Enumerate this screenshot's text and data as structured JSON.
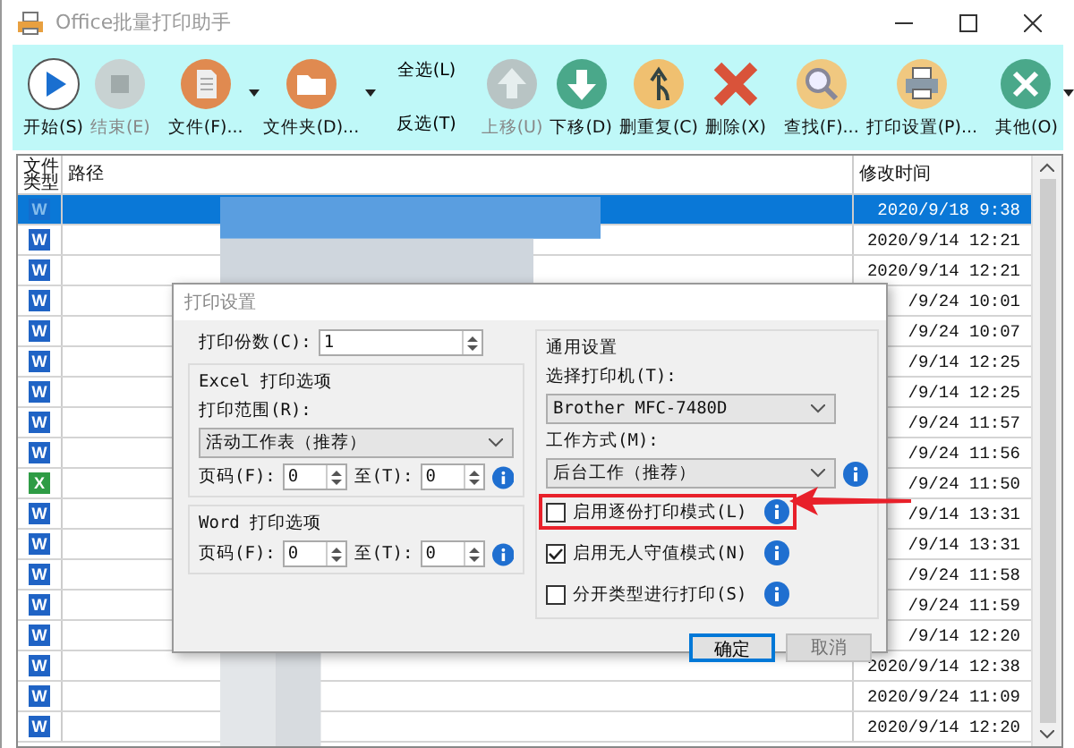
{
  "window": {
    "title": "Office批量打印助手"
  },
  "toolbar": [
    {
      "kind": "button",
      "label": "开始(S)",
      "disabled": false,
      "dropdown": false
    },
    {
      "kind": "button",
      "label": "结束(E)",
      "disabled": true,
      "dropdown": false
    },
    {
      "kind": "separator"
    },
    {
      "kind": "button",
      "label": "文件(F)...",
      "disabled": false,
      "dropdown": true
    },
    {
      "kind": "button",
      "label": "文件夹(D)...",
      "disabled": false,
      "dropdown": true
    },
    {
      "kind": "separator"
    },
    {
      "kind": "stack",
      "labels": [
        "全选(L)",
        "反选(T)"
      ]
    },
    {
      "kind": "separator"
    },
    {
      "kind": "button",
      "label": "上移(U)",
      "disabled": true,
      "dropdown": false
    },
    {
      "kind": "button",
      "label": "下移(D)",
      "disabled": false,
      "dropdown": false
    },
    {
      "kind": "button",
      "label": "删重复(C)",
      "disabled": false,
      "dropdown": false
    },
    {
      "kind": "button",
      "label": "删除(X)",
      "disabled": false,
      "dropdown": false
    },
    {
      "kind": "separator"
    },
    {
      "kind": "button",
      "label": "查找(F)...",
      "disabled": false,
      "dropdown": false
    },
    {
      "kind": "button",
      "label": "打印设置(P)...",
      "disabled": false,
      "dropdown": false
    },
    {
      "kind": "separator"
    },
    {
      "kind": "button",
      "label": "其他(O)",
      "disabled": false,
      "dropdown": true
    }
  ],
  "table": {
    "columns": [
      "文件类型",
      "路径",
      "修改时间"
    ],
    "rows": [
      {
        "kind": "word",
        "letter": "W",
        "time": "2020/9/18 9:38",
        "selected": true
      },
      {
        "kind": "word",
        "letter": "W",
        "time": "2020/9/14 12:21",
        "selected": false
      },
      {
        "kind": "word",
        "letter": "W",
        "time": "2020/9/14 12:21",
        "selected": false
      },
      {
        "kind": "word",
        "letter": "W",
        "time": "/9/24 10:01",
        "selected": false
      },
      {
        "kind": "word",
        "letter": "W",
        "time": "/9/24 10:07",
        "selected": false
      },
      {
        "kind": "word",
        "letter": "W",
        "time": "/9/14 12:25",
        "selected": false
      },
      {
        "kind": "word",
        "letter": "W",
        "time": "/9/14 12:25",
        "selected": false
      },
      {
        "kind": "word",
        "letter": "W",
        "time": "/9/24 11:57",
        "selected": false
      },
      {
        "kind": "word",
        "letter": "W",
        "time": "/9/24 11:56",
        "selected": false
      },
      {
        "kind": "excel",
        "letter": "X",
        "time": "/9/24 11:50",
        "selected": false
      },
      {
        "kind": "word",
        "letter": "W",
        "time": "/9/14 13:31",
        "selected": false
      },
      {
        "kind": "word",
        "letter": "W",
        "time": "/9/14 13:31",
        "selected": false
      },
      {
        "kind": "word",
        "letter": "W",
        "time": "/9/24 11:58",
        "selected": false
      },
      {
        "kind": "word",
        "letter": "W",
        "time": "/9/24 11:59",
        "selected": false
      },
      {
        "kind": "word",
        "letter": "W",
        "time": "/9/14 12:20",
        "selected": false
      },
      {
        "kind": "word",
        "letter": "W",
        "time": "2020/9/14 12:38",
        "selected": false
      },
      {
        "kind": "word",
        "letter": "W",
        "time": "2020/9/24 11:09",
        "selected": false
      },
      {
        "kind": "word",
        "letter": "W",
        "time": "2020/9/14 12:20",
        "selected": false
      }
    ]
  },
  "dialog": {
    "title": "打印设置",
    "copies": {
      "label": "打印份数(C):",
      "value": "1"
    },
    "excel": {
      "title": "Excel 打印选项",
      "range_label": "打印范围(R):",
      "range_value": "活动工作表（推荐）",
      "page_label": "页码(F):",
      "page_from": "0",
      "to_label": "至(T):",
      "page_to": "0"
    },
    "word": {
      "title": "Word 打印选项",
      "page_label": "页码(F):",
      "page_from": "0",
      "to_label": "至(T):",
      "page_to": "0"
    },
    "general": {
      "title": "通用设置",
      "printer_label": "选择打印机(T):",
      "printer_value": "Brother MFC-7480D",
      "mode_label": "工作方式(M):",
      "mode_value": "后台工作（推荐）",
      "options": [
        {
          "label": "启用逐份打印模式(L)",
          "checked": false,
          "highlighted": true
        },
        {
          "label": "启用无人守值模式(N)",
          "checked": true,
          "highlighted": false
        },
        {
          "label": "分开类型进行打印(S)",
          "checked": false,
          "highlighted": false
        }
      ]
    },
    "buttons": [
      {
        "label": "确定",
        "disabled": false
      },
      {
        "label": "取消",
        "disabled": true
      }
    ]
  }
}
